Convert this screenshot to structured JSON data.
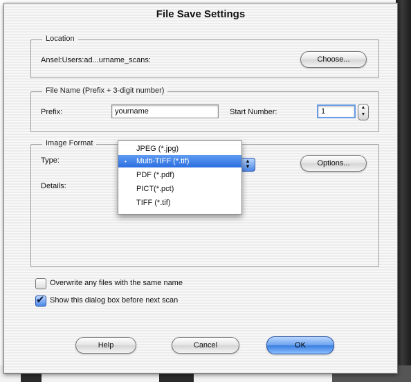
{
  "dialog": {
    "title": "File Save Settings"
  },
  "location": {
    "legend": "Location",
    "path": "Ansel:Users:ad...urname_scans:",
    "choose_label": "Choose..."
  },
  "file_name": {
    "legend": "File Name (Prefix + 3-digit number)",
    "prefix_label": "Prefix:",
    "prefix_value": "yourname",
    "start_label": "Start Number:",
    "start_value": "1"
  },
  "image_format": {
    "legend": "Image Format",
    "type_label": "Type:",
    "details_label": "Details:",
    "options_label": "Options...",
    "menu": {
      "items": [
        "JPEG (*.jpg)",
        "Multi-TIFF (*.tif)",
        "PDF (*.pdf)",
        "PICT(*.pct)",
        "TIFF (*.tif)"
      ],
      "selected": "Multi-TIFF (*.tif)",
      "selected_marker": "•"
    }
  },
  "checkboxes": {
    "overwrite": {
      "label": "Overwrite any files with the same name",
      "checked": false
    },
    "show_dialog": {
      "label": "Show this dialog box before next scan",
      "checked": true
    }
  },
  "buttons": {
    "help": "Help",
    "cancel": "Cancel",
    "ok": "OK"
  },
  "colors": {
    "accent": "#3a7ee0",
    "default_button": "#6fa4ee"
  }
}
